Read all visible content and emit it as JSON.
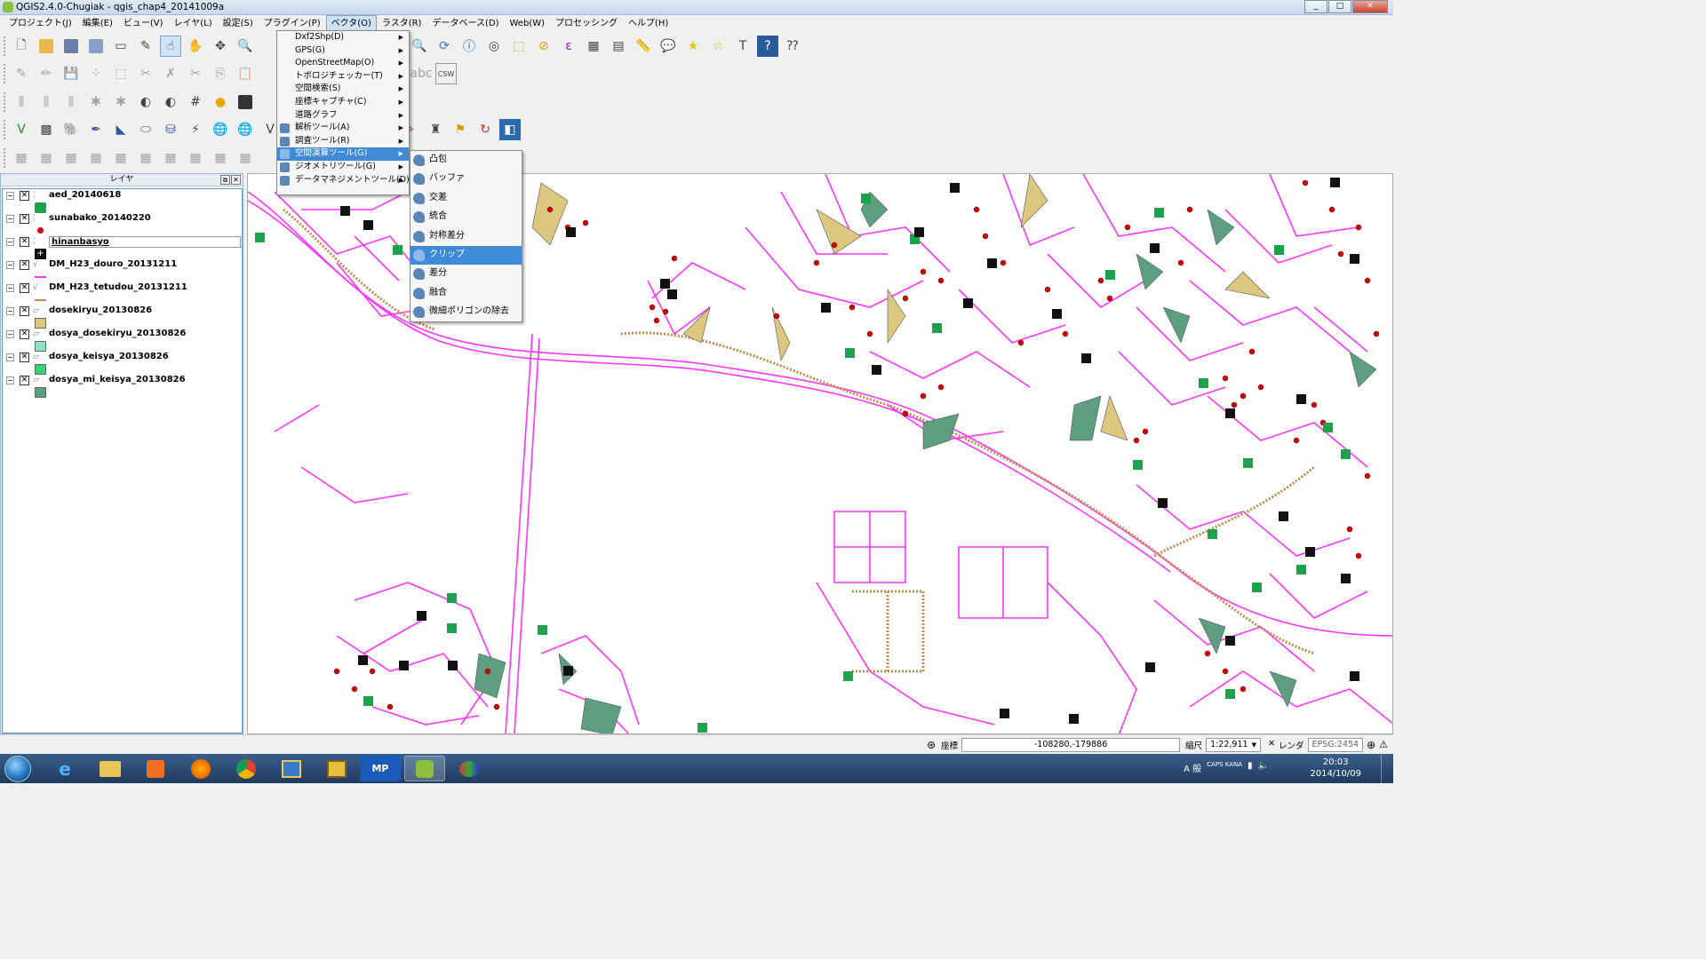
{
  "window": {
    "title": "QGIS2.4.0-Chugiak - qgis_chap4_20141009a",
    "buttons": [
      "_",
      "□",
      "✕"
    ]
  },
  "menubar": {
    "items": [
      "プロジェクト(J)",
      "編集(E)",
      "ビュー(V)",
      "レイヤ(L)",
      "設定(S)",
      "プラグイン(P)",
      "ベクタ(O)",
      "ラスタ(R)",
      "データベース(D)",
      "Web(W)",
      "プロセッシング",
      "ヘルプ(H)"
    ],
    "active": "ベクタ(O)"
  },
  "vector_menu": {
    "items": [
      {
        "label": "Dxf2Shp(D)",
        "submenu": true
      },
      {
        "label": "GPS(G)",
        "submenu": true
      },
      {
        "label": "OpenStreetMap(O)",
        "submenu": true
      },
      {
        "label": "トポロジチェッカー(T)",
        "submenu": true
      },
      {
        "label": "空間検索(S)",
        "submenu": true
      },
      {
        "label": "座標キャプチャ(C)",
        "submenu": true
      },
      {
        "label": "道路グラフ",
        "submenu": true
      },
      {
        "label": "解析ツール(A)",
        "submenu": true
      },
      {
        "label": "調査ツール(R)",
        "submenu": true
      },
      {
        "label": "空間演算ツール(G)",
        "submenu": true,
        "highlighted": true
      },
      {
        "label": "ジオメトリツール(G)",
        "submenu": true
      },
      {
        "label": "データマネジメントツール(D)",
        "submenu": true
      }
    ]
  },
  "geoprocessing_submenu": {
    "items": [
      "凸包",
      "バッファ",
      "交差",
      "統合",
      "対称差分",
      "クリップ",
      "差分",
      "融合",
      "微細ポリゴンの除去"
    ],
    "highlighted": "クリップ"
  },
  "layers_panel": {
    "title": "レイヤ",
    "layers": [
      {
        "name": "aed_20140618",
        "symbol": "aed",
        "checked": true
      },
      {
        "name": "sunabako_20140220",
        "symbol": "red-dot",
        "checked": true
      },
      {
        "name": "hinanbasyo",
        "symbol": "black-cross",
        "checked": true,
        "selected": true
      },
      {
        "name": "DM_H23_douro_20131211",
        "symbol": "magenta-line",
        "checked": true
      },
      {
        "name": "DM_H23_tetudou_20131211",
        "symbol": "brown-line",
        "checked": true
      },
      {
        "name": "dosekiryu_20130826",
        "symbol": "tan-fill",
        "checked": true
      },
      {
        "name": "dosya_dosekiryu_20130826",
        "symbol": "teal-fill",
        "checked": true
      },
      {
        "name": "dosya_keisya_20130826",
        "symbol": "green-fill",
        "checked": true
      },
      {
        "name": "dosya_mi_keisya_20130826",
        "symbol": "dark-green-fill",
        "checked": true
      }
    ]
  },
  "statusbar": {
    "coord_label": "座標",
    "coord_value": "-108280,-179886",
    "scale_label": "縮尺",
    "scale_value": "1:22,911",
    "render_label": "レンダ",
    "crs": "EPSG:2454"
  },
  "taskbar": {
    "apps": [
      "internet-explorer",
      "explorer",
      "media-player",
      "firefox",
      "chrome",
      "app-6",
      "app-7",
      "MP",
      "qgis",
      "paint"
    ],
    "mp_label": "MP",
    "clock_time": "20:03",
    "clock_date": "2014/10/09",
    "ime": "A 般",
    "tray_caps": "CAPS KANA"
  },
  "colors": {
    "roads": "#ff33ff",
    "sunabako": "#d00000",
    "aed": "#1aa34a",
    "menu_highlight": "#3f8bd8"
  }
}
